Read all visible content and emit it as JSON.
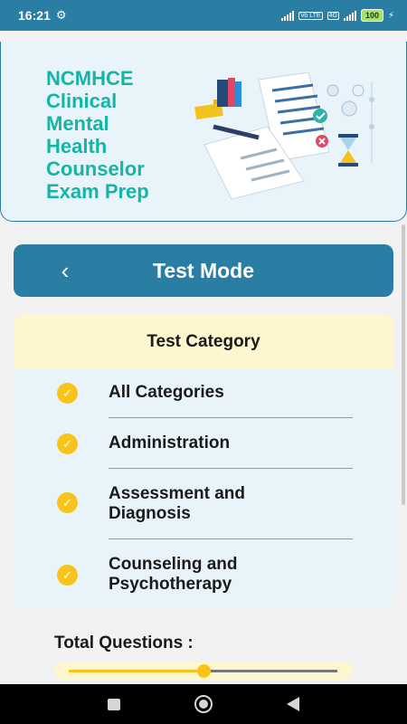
{
  "status_bar": {
    "time": "16:21",
    "gear_icon": "gear-icon",
    "volte_tag": "Vo LTE",
    "network_tag": "4G",
    "battery": "100",
    "charging_icon": "bolt-icon"
  },
  "header": {
    "title_lines": [
      "NCMHCE",
      "Clinical",
      "Mental",
      "Health",
      "Counselor",
      "Exam Prep"
    ]
  },
  "mode_bar": {
    "back_icon": "chevron-left-icon",
    "title": "Test Mode"
  },
  "category_card": {
    "header": "Test Category",
    "items": [
      {
        "label_lines": [
          "All Categories"
        ],
        "checked": true
      },
      {
        "label_lines": [
          "Administration"
        ],
        "checked": true
      },
      {
        "label_lines": [
          "Assessment and",
          "Diagnosis"
        ],
        "checked": true
      },
      {
        "label_lines": [
          "Counseling and",
          "Psychotherapy"
        ],
        "checked": true
      }
    ]
  },
  "total_questions": {
    "label": "Total Questions :",
    "slider_fraction": 0.5
  },
  "colors": {
    "primary": "#2a7ea4",
    "title_teal": "#14b5a6",
    "accent_yellow": "#f8c41c",
    "card_blue": "#e9f4fa",
    "card_cream": "#fdf6cf"
  },
  "nav_bar": {
    "icons": [
      "recent-apps-icon",
      "home-icon",
      "back-triangle-icon"
    ]
  }
}
